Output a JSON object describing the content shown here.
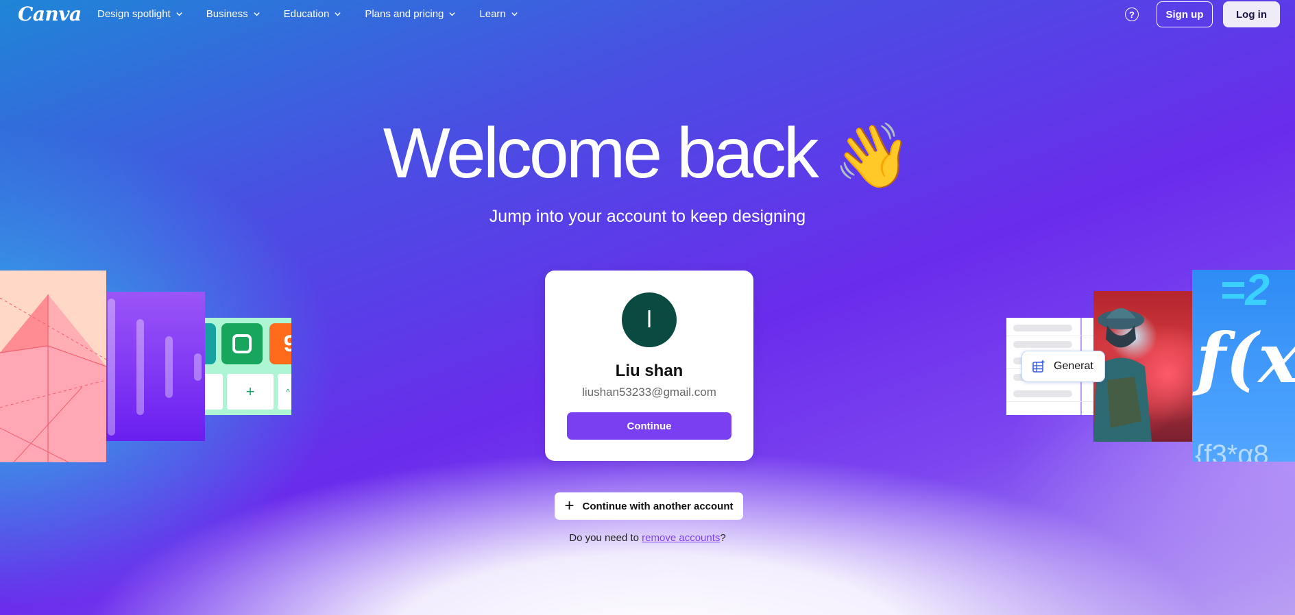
{
  "nav": {
    "logo": "Canva",
    "items": [
      {
        "label": "Design spotlight"
      },
      {
        "label": "Business"
      },
      {
        "label": "Education"
      },
      {
        "label": "Plans and pricing"
      },
      {
        "label": "Learn"
      }
    ],
    "help": "?",
    "signup": "Sign up",
    "login": "Log in"
  },
  "hero": {
    "title": "Welcome back",
    "wave_emoji": "👋",
    "subtitle": "Jump into your account to keep designing"
  },
  "account": {
    "avatar_initial": "l",
    "name": "Liu shan",
    "email": "liushan53233@gmail.com",
    "continue": "Continue"
  },
  "another_account": "Continue with another account",
  "remove": {
    "prefix": "Do you need to ",
    "link": "remove accounts",
    "suffix": "?"
  },
  "collage": {
    "generate_label": "Generat",
    "math_text": "f(x)",
    "math_top": "=2",
    "math_bottom": "{f3*α8"
  },
  "colors": {
    "accent": "#7b3ff2",
    "avatar_bg": "#0a4a40"
  }
}
